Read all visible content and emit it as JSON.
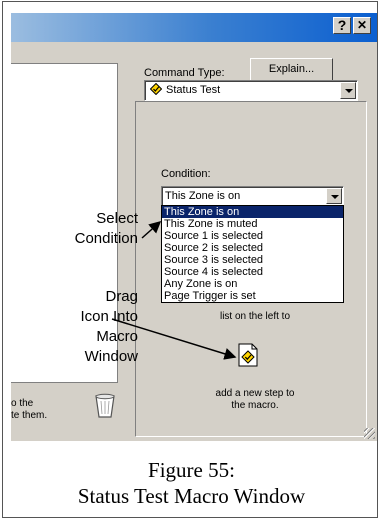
{
  "titlebar": {
    "help_label": "?",
    "close_label": "✕"
  },
  "command_type": {
    "label": "Command Type:",
    "explain_button": "Explain...",
    "selected_value": "Status Test"
  },
  "condition": {
    "label": "Condition:",
    "selected_value": "This Zone is on",
    "options": [
      "This Zone is on",
      "This Zone is muted",
      "Source 1 is selected",
      "Source 2 is selected",
      "Source 3 is selected",
      "Source 4 is selected",
      "Any Zone is on",
      "Page Trigger is set"
    ]
  },
  "hint": {
    "line1": "list on the left to",
    "line2": "add a new step to",
    "line3": "the macro."
  },
  "left_panel_text": {
    "line1": "o the",
    "line2": "te them."
  },
  "callouts": {
    "select": [
      "Select",
      "Condition"
    ],
    "drag": [
      "Drag",
      "Icon Into",
      "Macro",
      "Window"
    ]
  },
  "caption": {
    "line1": "Figure 55:",
    "line2": "Status Test Macro Window"
  },
  "colors": {
    "selection": "#0a246a",
    "dialog": "#d4d0c8",
    "title_gradient_end": "#0b5fd0"
  }
}
